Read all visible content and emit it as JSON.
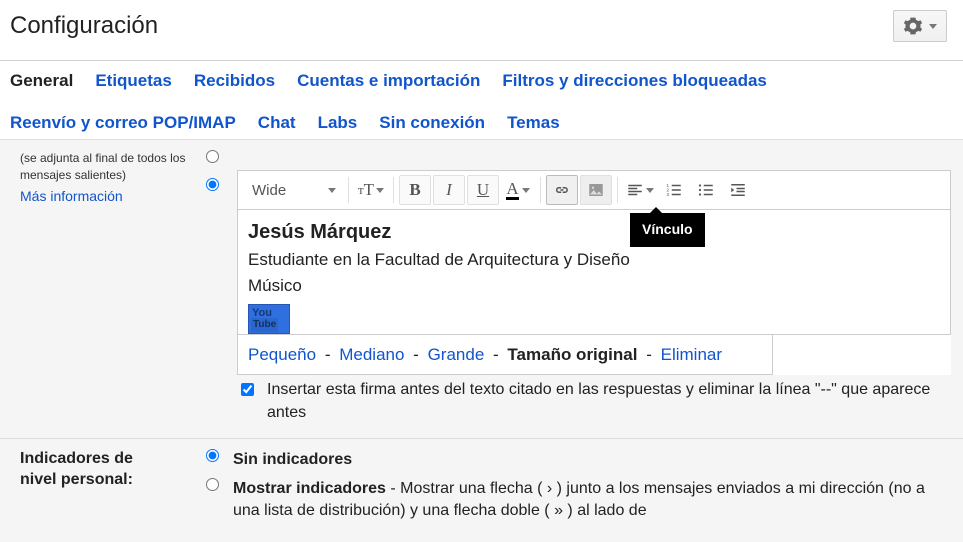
{
  "page_title": "Configuración",
  "gear_icon": "gear",
  "tabs": [
    {
      "label": "General",
      "active": true
    },
    {
      "label": "Etiquetas"
    },
    {
      "label": "Recibidos"
    },
    {
      "label": "Cuentas e importación"
    },
    {
      "label": "Filtros y direcciones bloqueadas"
    },
    {
      "label": "Reenvío y correo POP/IMAP"
    },
    {
      "label": "Chat"
    },
    {
      "label": "Labs"
    },
    {
      "label": "Sin conexión"
    },
    {
      "label": "Temas"
    }
  ],
  "signature_section": {
    "note": "(se adjunta al final de todos los mensajes salientes)",
    "learn_more": "Más información",
    "font_selector_value": "Wide",
    "tooltip_text": "Vínculo",
    "name": "Jesús Márquez",
    "line1": "Estudiante en la Facultad de Arquitectura y Diseño",
    "line2": "Músico",
    "size_options": {
      "small": "Pequeño",
      "medium": "Mediano",
      "large": "Grande",
      "original": "Tamaño original",
      "remove": "Eliminar"
    },
    "insert_before_label": "Insertar esta firma antes del texto citado en las respuestas y eliminar la línea \"--\" que aparece antes",
    "insert_before_checked": true
  },
  "indicators_section": {
    "title1": "Indicadores de",
    "title2": "nivel personal:",
    "no_indicators_label": "Sin indicadores",
    "show_indicators_bold": "Mostrar indicadores",
    "show_indicators_rest": " - Mostrar una flecha ( › ) junto a los mensajes enviados a mi dirección (no a una lista de distribución) y una flecha doble ( » ) al lado de"
  }
}
